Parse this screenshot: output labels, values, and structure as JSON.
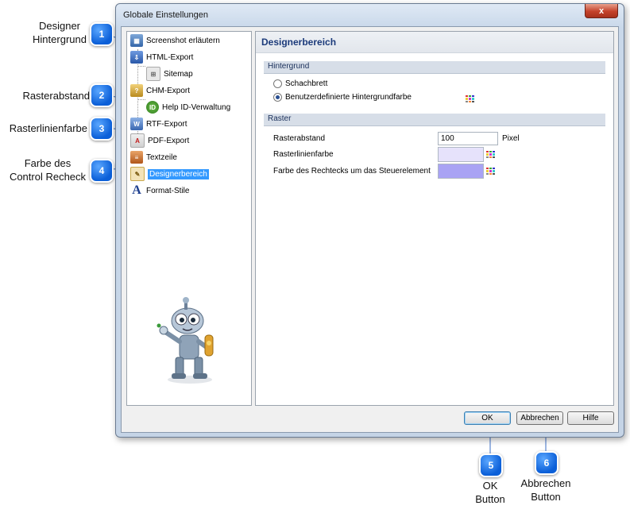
{
  "dialog": {
    "title": "Globale Einstellungen",
    "close_label": "x"
  },
  "tree": {
    "items": [
      {
        "label": "Screenshot erläutern",
        "icon": "screenshot-icon"
      },
      {
        "label": "HTML-Export",
        "icon": "html-export-icon"
      },
      {
        "label": "Sitemap",
        "icon": "sitemap-icon"
      },
      {
        "label": "CHM-Export",
        "icon": "chm-export-icon"
      },
      {
        "label": "Help ID-Verwaltung",
        "icon": "help-id-icon",
        "glyph": "ID"
      },
      {
        "label": "RTF-Export",
        "icon": "rtf-export-icon"
      },
      {
        "label": "PDF-Export",
        "icon": "pdf-export-icon"
      },
      {
        "label": "Textzeile",
        "icon": "textzeile-icon"
      },
      {
        "label": "Designerbereich",
        "icon": "designer-icon",
        "selected": true
      },
      {
        "label": "Format-Stile",
        "icon": "format-icon",
        "glyph": "A"
      }
    ]
  },
  "panel": {
    "title": "Designerbereich",
    "background_section": "Hintergrund",
    "radio_checkerboard": "Schachbrett",
    "radio_custom": "Benutzerdefinierte Hintergrundfarbe",
    "grid_section": "Raster",
    "grid_spacing_label": "Rasterabstand",
    "grid_spacing_value": "100",
    "grid_spacing_unit": "Pixel",
    "grid_line_color_label": "Rasterlinienfarbe",
    "rect_color_label": "Farbe des Rechtecks um das Steuerelement",
    "colors": {
      "grid_line_color": "#e6e2fb",
      "rect_color": "#a9a3f4"
    }
  },
  "buttons": {
    "ok": "OK",
    "cancel": "Abbrechen",
    "help": "Hilfe"
  },
  "annotations": {
    "a1": {
      "number": "1",
      "line1": "Designer",
      "line2": "Hintergrund"
    },
    "a2": {
      "number": "2",
      "line1": "Rasterabstand"
    },
    "a3": {
      "number": "3",
      "line1": "Rasterlinienfarbe"
    },
    "a4": {
      "number": "4",
      "line1": "Farbe des",
      "line2": "Control Recheck"
    },
    "a5": {
      "number": "5",
      "line1": "OK",
      "line2": "Button"
    },
    "a6": {
      "number": "6",
      "line1": "Abbrechen",
      "line2": "Button"
    }
  }
}
